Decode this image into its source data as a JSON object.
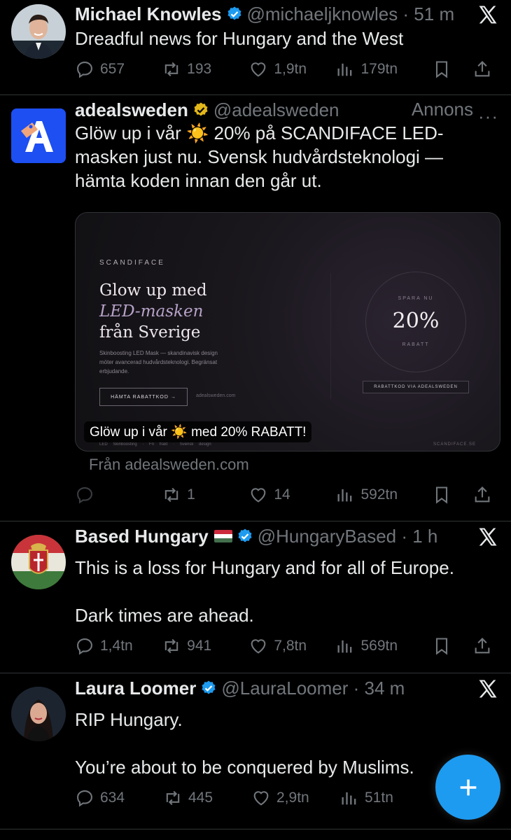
{
  "tweets": [
    {
      "name": "Michael Knowles",
      "handle": "@michaeljknowles · 51 m",
      "text": [
        "Dreadful news for Hungary and the West"
      ],
      "replies": "657",
      "reposts": "193",
      "likes": "1,9tn",
      "views": "179tn"
    },
    {
      "name": "adealsweden",
      "handle": "@adealsweden",
      "ad_label": "Annons",
      "text": [
        "Glöw up i vår ☀️ 20% på SCANDIFACE LED-masken just nu. Svensk hudvårdsteknologi — hämta koden innan den går ut."
      ],
      "media": {
        "brand": "SCANDIFACE",
        "title_line1": "Glow up med",
        "title_line2": "LED-masken",
        "title_line3": "från Sverige",
        "description": "Skinboosting LED Mask — skandinavisk design möter avancerad hudvårdsteknologi. Begränsat erbjudande.",
        "button": "HÄMTA RABATTKOD →",
        "site": "adealsweden.com",
        "save_label": "SPARA NU",
        "percent": "20%",
        "rabatt_label": "RABATT",
        "code_label": "RABATTKOD VIA ADEALSWEDEN",
        "footer_left": "LED Skinboosting · Fri frakt · Svensk design",
        "footer_right": "SCANDIFACE.SE",
        "caption": "Glöw up i vår ☀️ med 20% RABATT!"
      },
      "source": "Från adealsweden.com",
      "replies": "",
      "reposts": "1",
      "likes": "14",
      "views": "592tn"
    },
    {
      "name": "Based Hungary",
      "handle": "@HungaryBased · 1 h",
      "text": [
        "This is a loss for Hungary and for all of Europe.",
        "",
        "Dark times are ahead."
      ],
      "replies": "1,4tn",
      "reposts": "941",
      "likes": "7,8tn",
      "views": "569tn"
    },
    {
      "name": "Laura Loomer",
      "handle": "@LauraLoomer · 34 m",
      "text": [
        "RIP Hungary.",
        "",
        "You’re about to be conquered by Muslims."
      ],
      "replies": "634",
      "reposts": "445",
      "likes": "2,9tn",
      "views": "51tn"
    }
  ],
  "colors": {
    "background": "#000000",
    "text": "#e7e9ea",
    "muted": "#71767b",
    "verified_blue": "#1d9bf0",
    "verified_gold": "#e2b719",
    "fab": "#1d9bf0"
  },
  "icons": [
    "reply-icon",
    "repost-icon",
    "like-icon",
    "views-icon",
    "bookmark-icon",
    "share-icon",
    "x-logo-icon",
    "compose-plus-icon"
  ]
}
